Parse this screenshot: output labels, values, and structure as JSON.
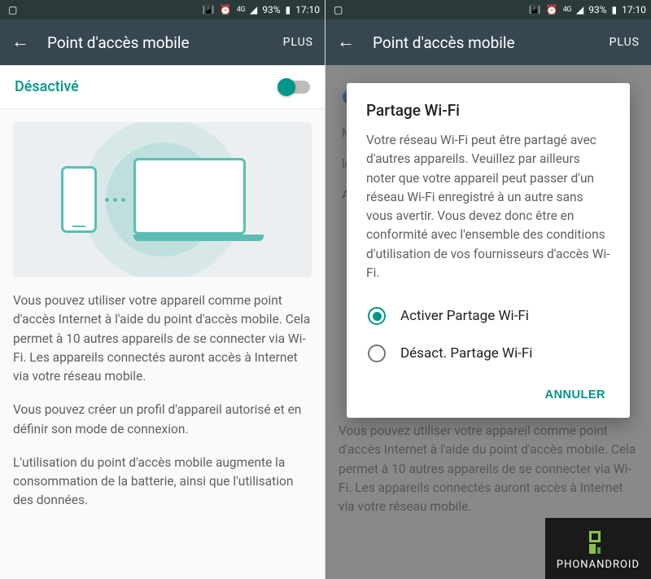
{
  "statusbar": {
    "network": "4G",
    "battery": "93%",
    "time": "17:10"
  },
  "appbar": {
    "title": "Point d'accès mobile",
    "action": "PLUS"
  },
  "toggle": {
    "label": "Désactivé"
  },
  "description": {
    "p1": "Vous pouvez utiliser votre appareil comme point d'accès Internet à l'aide du point d'accès mobile. Cela permet à 10 autres appareils de se connecter via Wi-Fi. Les appareils connectés auront accès à Internet via votre réseau mobile.",
    "p2": "Vous pouvez créer un profil d'appareil autorisé et en définir son mode de connexion.",
    "p3": "L'utilisation du point d'accès mobile augmente la consommation de la batterie, ainsi que l'utilisation des données."
  },
  "dialog": {
    "title": "Partage Wi-Fi",
    "message": "Votre réseau Wi-Fi peut être partagé avec d'autres appareils. Veuillez par ailleurs noter que votre appareil peut passer d'un réseau Wi-Fi enregistré à un autre sans vous avertir. Vous devez donc être en conformité avec l'ensemble des conditions d'utilisation de vos fournisseurs d'accès Wi-Fi.",
    "option_enable": "Activer Partage Wi-Fi",
    "option_disable": "Désact. Partage Wi-Fi",
    "cancel": "ANNULER"
  },
  "bg_hints": {
    "row1": "M",
    "row2": "le",
    "row3": "Ai",
    "body": "Vous pouvez utiliser votre appareil comme point d'accès Internet à l'aide du point d'accès mobile. Cela permet à 10 autres appareils de se connecter via Wi-Fi. Les appareils connectés auront accès à Internet via votre réseau mobile."
  },
  "watermark": {
    "text": "PHONANDROID"
  }
}
